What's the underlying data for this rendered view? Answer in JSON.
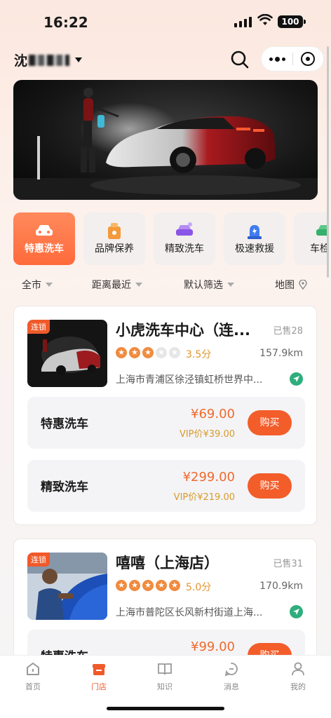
{
  "status": {
    "time": "16:22",
    "battery": "100"
  },
  "header": {
    "location": "沈"
  },
  "categories": [
    "特惠洗车",
    "品牌保养",
    "精致洗车",
    "极速救援",
    "车检代"
  ],
  "filters": {
    "city": "全市",
    "sort": "距离最近",
    "filter": "默认筛选",
    "map": "地图"
  },
  "stores": [
    {
      "tag": "连锁",
      "name": "小虎洗车中心（连...",
      "sold": "已售28",
      "rating": 3,
      "score": "3.5分",
      "distance": "157.9km",
      "address": "上海市青浦区徐泾镇虹桥世界中...",
      "services": [
        {
          "name": "特惠洗车",
          "price": "¥69.00",
          "vip": "VIP价¥39.00",
          "button": "购买"
        },
        {
          "name": "精致洗车",
          "price": "¥299.00",
          "vip": "VIP价¥219.00",
          "button": "购买"
        }
      ]
    },
    {
      "tag": "连锁",
      "name": "嘻嘻（上海店）",
      "sold": "已售31",
      "rating": 5,
      "score": "5.0分",
      "distance": "170.9km",
      "address": "上海市普陀区长风新村街道上海...",
      "services": [
        {
          "name": "特惠洗车",
          "price": "¥99.00",
          "button": "购买"
        }
      ]
    }
  ],
  "tabbar": [
    "首页",
    "门店",
    "知识",
    "消息",
    "我的"
  ],
  "colors": {
    "accent": "#f05a2a",
    "price": "#f06a2d",
    "vip": "#d89a2c",
    "rating": "#f08b3f"
  }
}
